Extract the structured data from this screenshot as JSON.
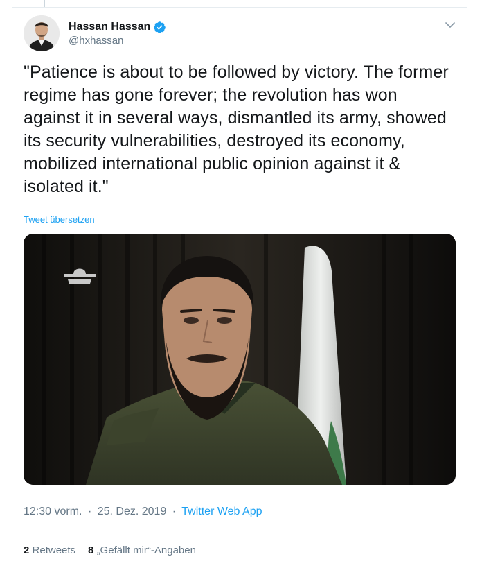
{
  "user": {
    "name": "Hassan Hassan",
    "handle": "@hxhassan",
    "verified": true
  },
  "tweet": {
    "text_lines": [
      "\"Patience is about to be followed by victory. The former",
      "regime has gone forever; the revolution has won",
      "against it in several ways, dismantled its army, showed",
      "its security vulnerabilities, destroyed its economy,",
      "mobilized international public opinion against it &",
      "isolated it.\""
    ],
    "translate_label": "Tweet übersetzen"
  },
  "meta": {
    "time": "12:30 vorm.",
    "date": "25. Dez. 2019",
    "separator": "·",
    "source": "Twitter Web App"
  },
  "stats": {
    "retweets_count": "2",
    "retweets_label": "Retweets",
    "likes_count": "8",
    "likes_label": "„Gefällt mir“-Angaben"
  },
  "icons": {
    "verified": "verified-badge-icon",
    "caret": "chevron-down-icon"
  },
  "colors": {
    "accent": "#1da1f2",
    "text": "#14171a",
    "muted": "#657786",
    "border": "#e6ecf0"
  }
}
